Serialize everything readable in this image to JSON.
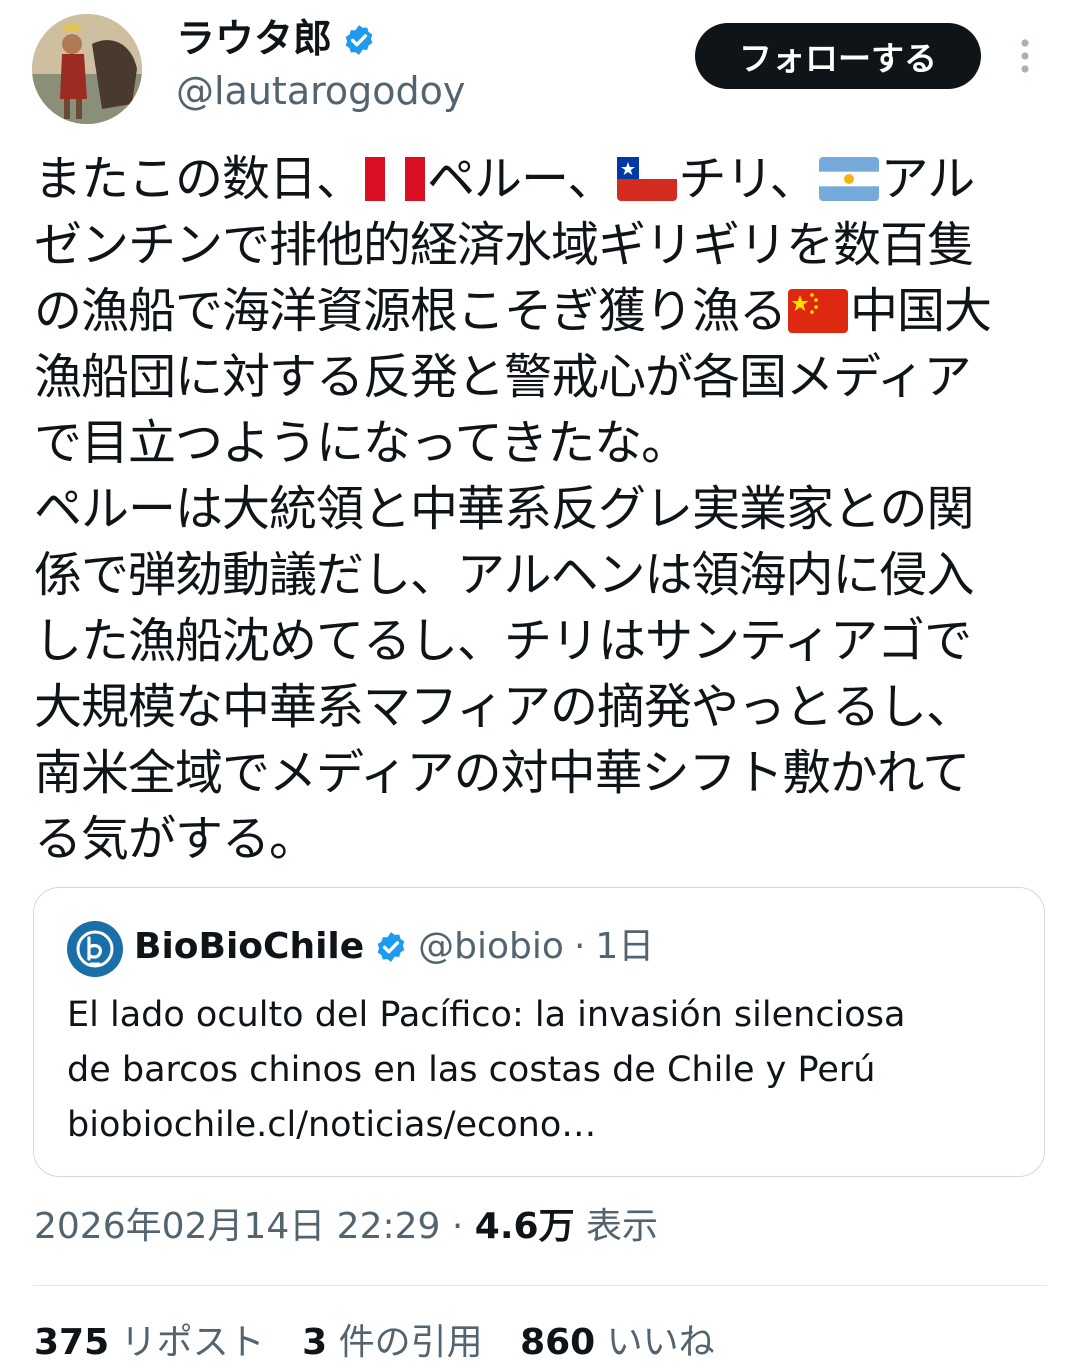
{
  "author": {
    "name": "ラウタ郎",
    "handle": "@lautarogodoy",
    "verified": true
  },
  "header": {
    "follow_label": "フォローする",
    "more_icon": "more-vertical-icon"
  },
  "tweet": {
    "lines": [
      [
        "またこの数日、",
        {
          "flag": "peru"
        },
        "ペルー、",
        {
          "flag": "chile"
        },
        "チリ、",
        {
          "flag": "argentina"
        },
        "アル"
      ],
      [
        "ゼンチンで排他的経済水域ギリギリを数百隻"
      ],
      [
        "の漁船で海洋資源根こそぎ獲り漁る",
        {
          "flag": "china"
        },
        "中国大"
      ],
      [
        "漁船団に対する反発と警戒心が各国メディア"
      ],
      [
        "で目立つようになってきたな。"
      ],
      [
        "ペルーは大統領と中華系反グレ実業家との関"
      ],
      [
        "係で弾劾動議だし、アルヘンは領海内に侵入"
      ],
      [
        "した漁船沈めてるし、チリはサンティアゴで"
      ],
      [
        "大規模な中華系マフィアの摘発やっとるし、"
      ],
      [
        "南米全域でメディアの対中華シフト敷かれて"
      ],
      [
        "る気がする。"
      ]
    ]
  },
  "quote": {
    "name": "BioBioChile",
    "handle": "@biobio",
    "separator": "·",
    "time": "1日",
    "text_lines": [
      "El lado oculto del Pacífico: la invasión silenciosa",
      "de barcos chinos en las costas de Chile y Perú",
      "biobiochile.cl/noticias/econo…"
    ]
  },
  "meta": {
    "datetime": "2026年02月14日 22:29",
    "separator": "·",
    "views_count": "4.6万",
    "views_label": "表示"
  },
  "stats": {
    "reposts_count": "375",
    "reposts_label": "リポスト",
    "quotes_count": "3",
    "quotes_label": "件の引用",
    "likes_count": "860",
    "likes_label": "いいね"
  },
  "colors": {
    "text": "#0f1419",
    "secondary": "#536471",
    "verified": "#1d9bf0",
    "border": "#cfd9de",
    "follow_bg": "#0f1419"
  }
}
